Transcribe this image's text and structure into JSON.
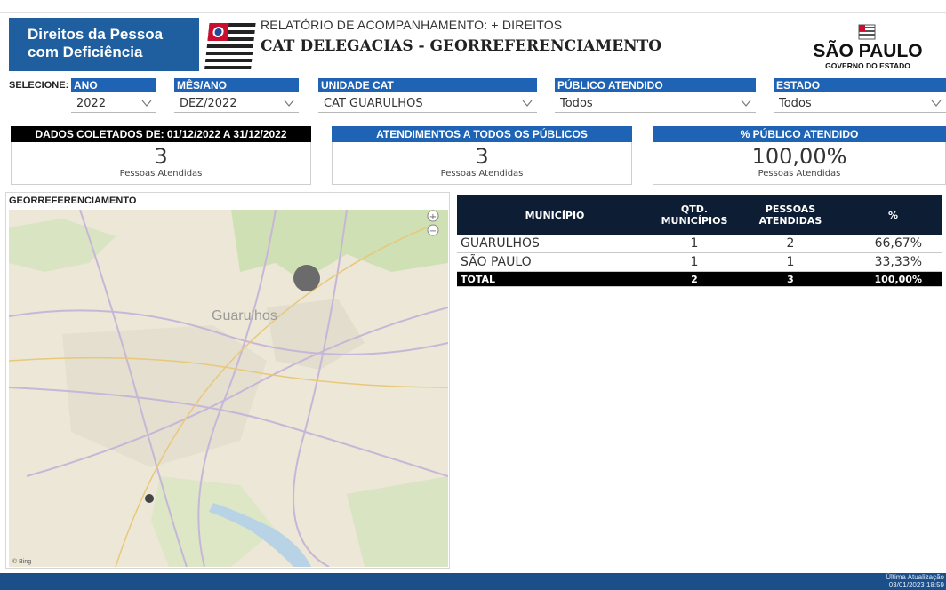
{
  "header": {
    "brand_line1": "Direitos da Pessoa",
    "brand_line2": "com Deficiência",
    "report_subtitle": "RELATÓRIO DE ACOMPANHAMENTO: + DIREITOS",
    "report_title": "CAT DELEGACIAS - GEORREFERENCIAMENTO",
    "logo_main": "SÃO PAULO",
    "logo_sub": "GOVERNO DO ESTADO"
  },
  "filters": {
    "selecione_label": "SELECIONE:",
    "ano": {
      "label": "ANO",
      "value": "2022"
    },
    "mes_ano": {
      "label": "MÊS/ANO",
      "value": "DEZ/2022"
    },
    "unidade_cat": {
      "label": "UNIDADE CAT",
      "value": "CAT GUARULHOS"
    },
    "publico": {
      "label": "PÚBLICO ATENDIDO",
      "value": "Todos"
    },
    "estado": {
      "label": "ESTADO",
      "value": "Todos"
    }
  },
  "kpis": [
    {
      "header": "DADOS COLETADOS DE: 01/12/2022 A 31/12/2022",
      "value": "3",
      "label": "Pessoas Atendidas"
    },
    {
      "header": "ATENDIMENTOS A TODOS OS PÚBLICOS",
      "value": "3",
      "label": "Pessoas Atendidas"
    },
    {
      "header": "% PÚBLICO ATENDIDO",
      "value": "100,00%",
      "label": "Pessoas Atendidas"
    }
  ],
  "map": {
    "title": "GEORREFERENCIAMENTO",
    "city_label": "Guarulhos",
    "zoom_in": "+",
    "zoom_out": "−",
    "attribution": "© Bing"
  },
  "table": {
    "headers": [
      "MUNICÍPIO",
      "QTD. MUNICÍPIOS",
      "PESSOAS ATENDIDAS",
      "%"
    ],
    "rows": [
      {
        "municipio": "GUARULHOS",
        "qtd": "1",
        "pessoas": "2",
        "pct": "66,67%"
      },
      {
        "municipio": "SÃO PAULO",
        "qtd": "1",
        "pessoas": "1",
        "pct": "33,33%"
      }
    ],
    "total": {
      "municipio": "TOTAL",
      "qtd": "2",
      "pessoas": "3",
      "pct": "100,00%"
    }
  },
  "footer": {
    "update_label": "Última Atualização",
    "update_value": "03/01/2023 18:59"
  },
  "colors": {
    "brand_blue": "#1f5f9f",
    "filter_blue": "#1f63b5",
    "kpi_dark": "#000000",
    "kpi_blue": "#1f63b5",
    "table_header": "#0d1d33",
    "footer_blue": "#1b4f8a"
  }
}
